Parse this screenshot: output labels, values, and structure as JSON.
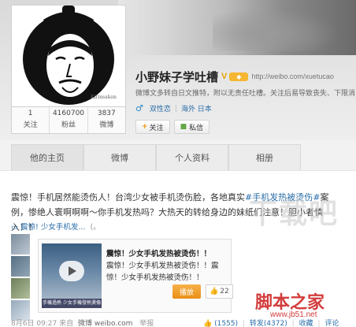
{
  "profile": {
    "name": "小野妹子学吐槽",
    "url": "http://weibo.com/xuetucao",
    "bio": "微博文多转自日文推特，附以无责任吐槽。关注后易导致丧失、下限消",
    "gender_symbol": "♂",
    "tags": [
      "双性恋",
      "海外 日本"
    ],
    "avatar_signature": "Kirinsakon"
  },
  "stats": [
    {
      "num": "1",
      "label": "关注"
    },
    {
      "num": "4160700",
      "label": "粉丝"
    },
    {
      "num": "3837",
      "label": "微博"
    }
  ],
  "buttons": {
    "follow": "关注",
    "message": "私信"
  },
  "nav": {
    "tabs": [
      "他的主页",
      "微博",
      "个人资料",
      "相册"
    ]
  },
  "post": {
    "prefix": "震惊！手机居然能烫伤人！台湾少女被手机烫伤脸，各地真实",
    "hashtag": "#手机发热被烫伤#",
    "suffix": "案例，惨绝人寰啊啊啊～你手机发热吗？大热天的转给身边的妹纸们注意！胆小者慎入！！",
    "repost_topic": "震惊! 少女手机发...",
    "repost_note": "(。"
  },
  "card": {
    "title": "震惊！少女手机发热被烫伤！！",
    "desc": "震惊！少女手机发热被烫伤！！震惊！少女手机发热被烫伤！！",
    "video_caption": "手機過熱 少女手機發熱燙傷",
    "play_label": "播放",
    "likes": "22"
  },
  "meta": {
    "time": "8月6日 09:27",
    "from": "来自",
    "source": "微博 weibo.com",
    "report": "举报",
    "like_count": "(1555)",
    "repost": "转发(4372)",
    "favorite": "收藏",
    "comment": "评论"
  },
  "watermark": {
    "big": "下载吧",
    "red": "脚本之家",
    "url": "www.jb51.net"
  }
}
